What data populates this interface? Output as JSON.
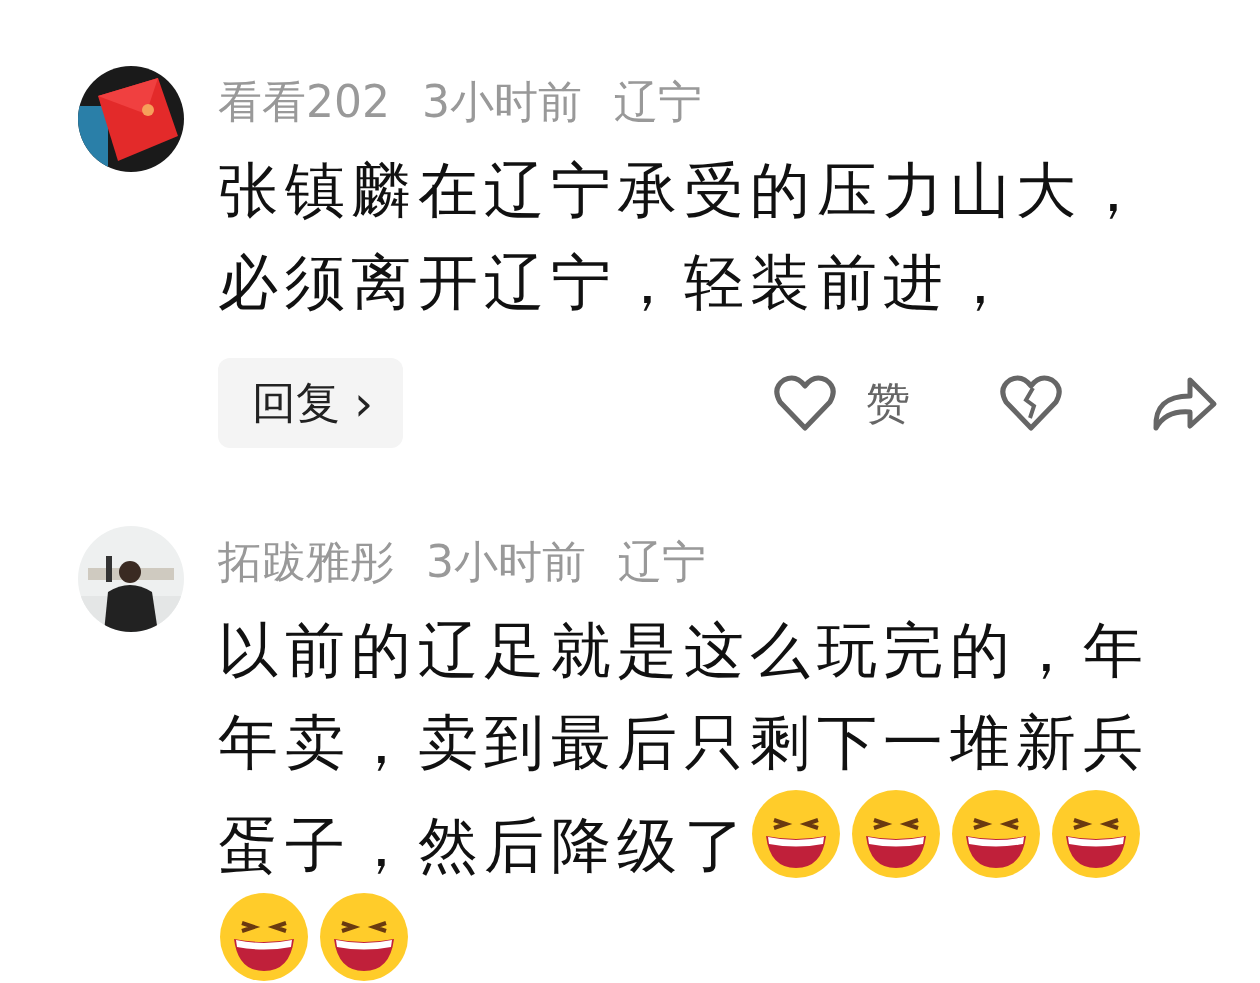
{
  "comments": [
    {
      "avatar": {
        "kind": "picture"
      },
      "user": "看看202",
      "time": "3小时前",
      "location": "辽宁",
      "lines": [
        "张镇麟在辽宁承受的压力山大，",
        "必须离开辽宁，轻装前进，"
      ],
      "actions": {
        "reply": "回复",
        "reply_arrow": "›",
        "like": "赞"
      }
    },
    {
      "avatar": {
        "kind": "picture"
      },
      "user": "拓跋雅彤",
      "time": "3小时前",
      "location": "辽宁",
      "lines": [
        "以前的辽足就是这么玩完的，年",
        "年卖，卖到最后只剩下一堆新兵",
        "蛋子，然后降级了"
      ],
      "emojis": [
        {
          "kind": "laugh"
        },
        {
          "kind": "laugh"
        },
        {
          "kind": "laugh"
        },
        {
          "kind": "laugh"
        },
        {
          "kind": "laugh"
        },
        {
          "kind": "laugh"
        }
      ]
    }
  ]
}
